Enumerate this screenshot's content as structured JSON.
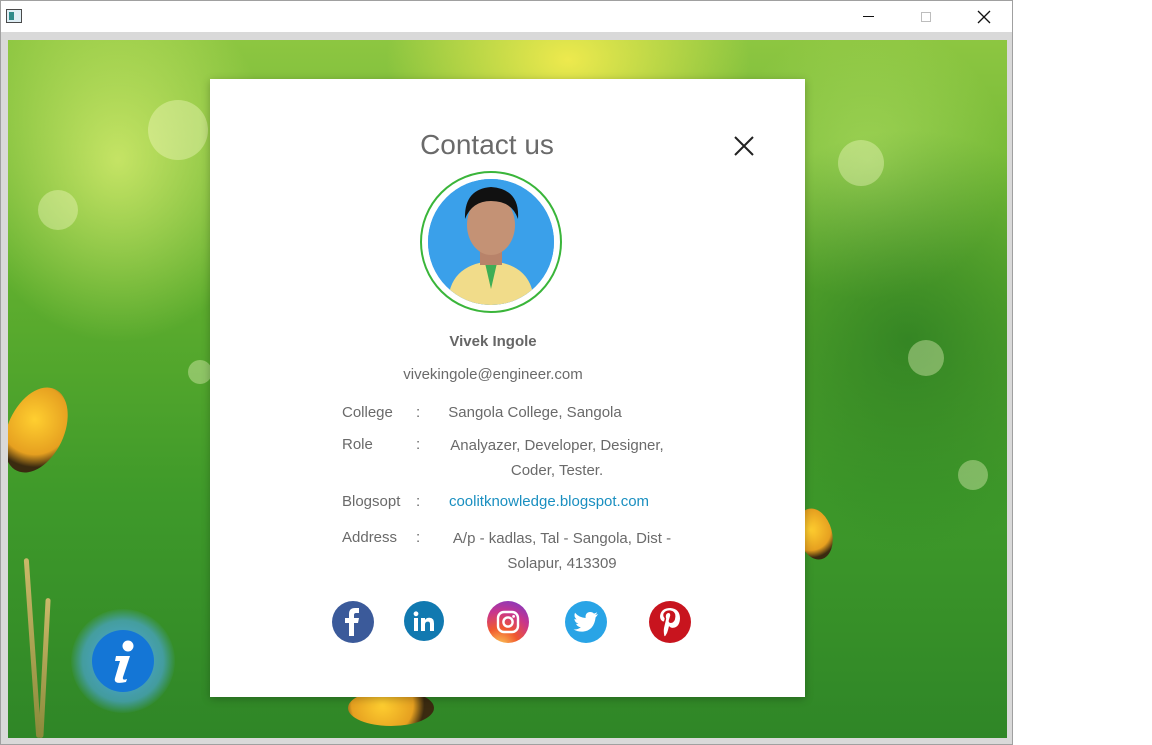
{
  "window": {
    "icon": "app-window-icon",
    "controls": [
      "minimize-icon",
      "maximize-icon",
      "close-icon"
    ]
  },
  "dialog": {
    "title": "Contact us",
    "name": "Vivek Ingole",
    "email": "vivekingole@engineer.com",
    "fields": [
      {
        "label": "College",
        "colon": ":",
        "value_lines": [
          "Sangola College, Sangola"
        ]
      },
      {
        "label": "Role",
        "colon": ":",
        "value_lines": [
          "Analyazer, Developer, Designer,",
          "Coder, Tester."
        ]
      },
      {
        "label": "Blogsopt",
        "colon": ":",
        "value_lines": [
          "coolitknowledge.blogspot.com"
        ]
      },
      {
        "label": "Address",
        "colon": ":",
        "value_lines": [
          "A/p - kadlas, Tal - Sangola, Dist -",
          "Solapur, 413309"
        ]
      }
    ],
    "social": [
      "facebook-icon",
      "linkedin-icon",
      "instagram-icon",
      "twitter-icon",
      "pinterest-icon"
    ],
    "avatar_ring_color": "#3ab53a",
    "link_color": "#1a8fc0"
  },
  "info_button": {
    "icon": "info-icon",
    "color": "#1476d6"
  }
}
